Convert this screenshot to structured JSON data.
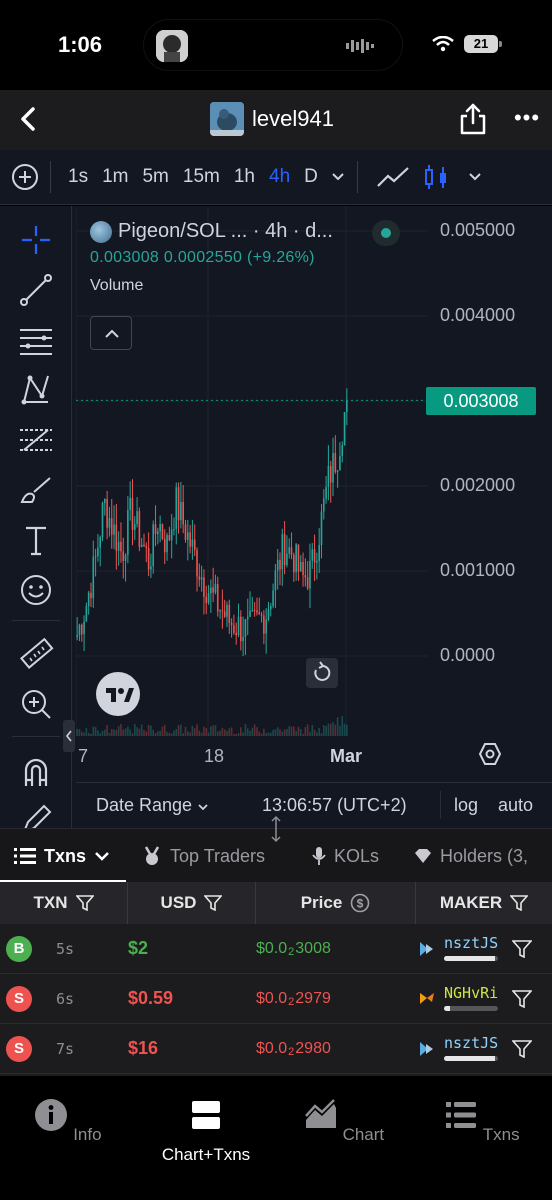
{
  "status_bar": {
    "time": "1:06",
    "battery": "21"
  },
  "header": {
    "title": "level941"
  },
  "toolbar": {
    "timeframes": [
      "1s",
      "1m",
      "5m",
      "15m",
      "1h",
      "4h",
      "D"
    ],
    "active_timeframe": "4h"
  },
  "chart_legend": {
    "symbol": "Pigeon/SOL ... · 4h · d...",
    "close": "0.003008",
    "change": "0.0002550",
    "change_pct": "(+9.26%)",
    "volume_label": "Volume"
  },
  "chart_data": {
    "type": "candlestick",
    "price_ticks": [
      "0.005000",
      "0.004000",
      "0.002000",
      "0.001000",
      "0.0000"
    ],
    "current_price_label": "0.003008",
    "x_tick_labels": [
      "7",
      "18",
      "Mar"
    ],
    "up_color": "#26a69a",
    "down_color": "#ef5350",
    "close_series": [
      0.00025,
      0.0006,
      0.0011,
      0.0018,
      0.0015,
      0.0012,
      0.0017,
      0.0014,
      0.0011,
      0.0016,
      0.0013,
      0.0018,
      0.0015,
      0.0012,
      0.0009,
      0.0007,
      0.00055,
      0.0004,
      0.00035,
      0.0003,
      0.0004,
      0.0005,
      0.0009,
      0.0013,
      0.0012,
      0.0009,
      0.001,
      0.0015,
      0.0021,
      0.0024,
      0.003008
    ]
  },
  "chart_footer": {
    "date_range": "Date Range",
    "time": "13:06:57 (UTC+2)",
    "log": "log",
    "auto": "auto"
  },
  "tabs": [
    {
      "label": "Txns",
      "active": true
    },
    {
      "label": "Top Traders",
      "active": false
    },
    {
      "label": "KOLs",
      "active": false
    },
    {
      "label": "Holders (3,",
      "active": false
    }
  ],
  "table": {
    "headers": [
      "TXN",
      "USD",
      "Price",
      "MAKER"
    ],
    "rows": [
      {
        "side": "B",
        "age": "5s",
        "usd": "$2",
        "price_prefix": "$0.0",
        "price_sub": "2",
        "price_rest": "3008",
        "maker": "nsztJS",
        "maker_share": 0.95,
        "maker_color": "#8fd4ff"
      },
      {
        "side": "S",
        "age": "6s",
        "usd": "$0.59",
        "price_prefix": "$0.0",
        "price_sub": "2",
        "price_rest": "2979",
        "maker": "NGHvRi",
        "maker_share": 0.12,
        "maker_color": "#c8e64a"
      },
      {
        "side": "S",
        "age": "7s",
        "usd": "$16",
        "price_prefix": "$0.0",
        "price_sub": "2",
        "price_rest": "2980",
        "maker": "nsztJS",
        "maker_share": 0.95,
        "maker_color": "#8fd4ff"
      }
    ]
  },
  "bottom_nav": [
    {
      "label": "Info",
      "icon": "info-icon",
      "active": false
    },
    {
      "label": "Chart+Txns",
      "icon": "split-icon",
      "active": true
    },
    {
      "label": "Chart",
      "icon": "chart-icon",
      "active": false
    },
    {
      "label": "Txns",
      "icon": "list-icon",
      "active": false
    }
  ],
  "colors": {
    "buy": "#4caf50",
    "sell": "#ef5350",
    "accent": "#2962ff",
    "teal": "#089981"
  }
}
